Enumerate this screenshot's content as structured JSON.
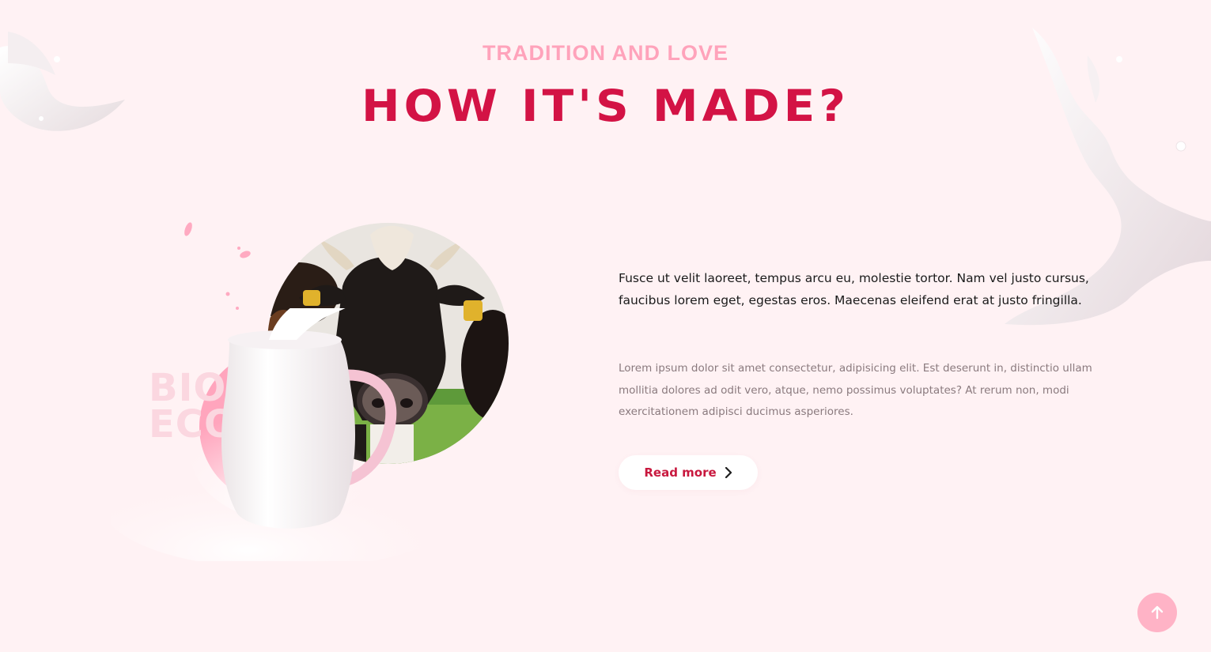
{
  "section": {
    "eyebrow": "TRADITION AND LOVE",
    "title": "HOW IT'S MADE?"
  },
  "visual": {
    "badge_line1": "BIO",
    "badge_line2": "ECO"
  },
  "content": {
    "lead": "Fusce ut velit laoreet, tempus arcu eu, molestie tortor. Nam vel justo cursus, faucibus lorem eget, egestas eros. Maecenas eleifend erat at justo fringilla.",
    "body": "Lorem ipsum dolor sit amet consectetur, adipisicing elit. Est deserunt in, distinctio ullam mollitia dolores ad odit vero, atque, nemo possimus voluptates? At rerum non, modi exercitationem adipisci ducimus asperiores.",
    "button_label": "Read more"
  },
  "icons": {
    "read_more": "chevron-right-icon",
    "scroll_top": "arrow-up-icon"
  },
  "colors": {
    "background": "#fff2f4",
    "accent": "#d31345",
    "eyebrow": "#ffa3bb",
    "scroll_top_button": "#ffb3c6"
  }
}
